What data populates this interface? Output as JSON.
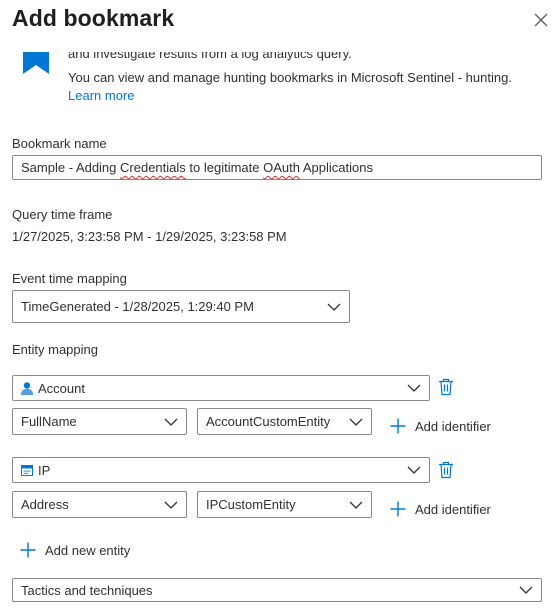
{
  "header": {
    "title": "Add bookmark"
  },
  "info": {
    "line1": "and investigate results from a log analytics query.",
    "line2": "You can view and manage hunting bookmarks in Microsoft Sentinel - hunting.",
    "learn_more": "Learn more"
  },
  "bookmark_name": {
    "label": "Bookmark name",
    "value_prefix": "Sample - Adding ",
    "value_misspelled_1": "Credentials",
    "value_mid": " to legitimate ",
    "value_misspelled_2": "OAuth",
    "value_suffix": " Applications"
  },
  "query_time_frame": {
    "label": "Query time frame",
    "value": "1/27/2025, 3:23:58 PM - 1/29/2025, 3:23:58 PM"
  },
  "event_time_mapping": {
    "label": "Event time mapping",
    "selected": "TimeGenerated - 1/28/2025, 1:29:40 PM"
  },
  "entity_mapping": {
    "label": "Entity mapping",
    "entities": [
      {
        "type": "Account",
        "identifier": "FullName",
        "column": "AccountCustomEntity",
        "add_identifier": "Add identifier"
      },
      {
        "type": "IP",
        "identifier": "Address",
        "column": "IPCustomEntity",
        "add_identifier": "Add identifier"
      }
    ],
    "add_new_entity": "Add new entity"
  },
  "tactics": {
    "selected": "Tactics and techniques"
  },
  "colors": {
    "accent": "#0078d4",
    "border": "#8a8886",
    "text": "#323130"
  },
  "icons": {
    "close": "close-icon",
    "info": "sentinel-bookmark-icon",
    "account": "account-icon",
    "ip": "ip-icon",
    "delete": "trash-icon",
    "add": "plus-icon",
    "chevron": "chevron-down-icon"
  }
}
